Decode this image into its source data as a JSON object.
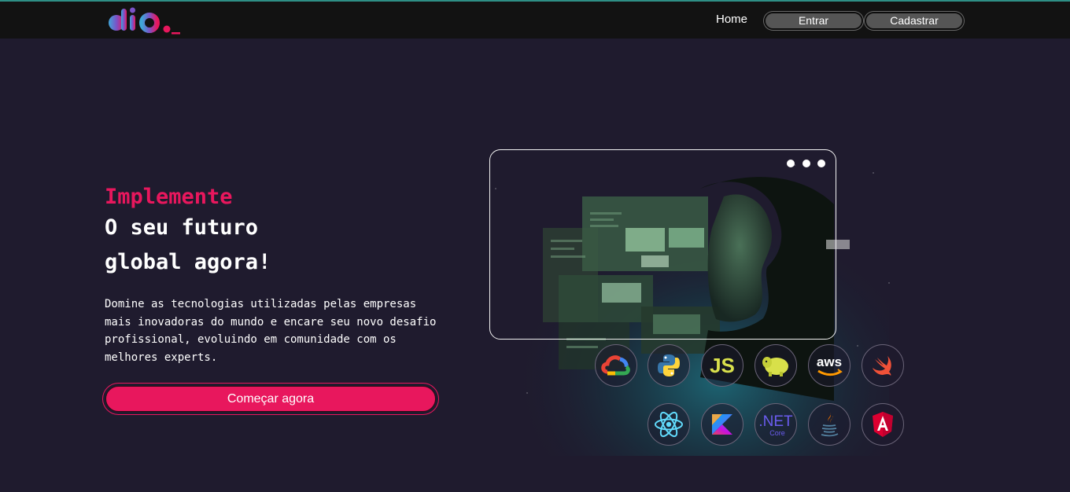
{
  "nav": {
    "home_label": "Home",
    "enter_label": "Entrar",
    "signup_label": "Cadastrar"
  },
  "hero": {
    "accent_line": "Implemente",
    "title_line1": "O seu futuro",
    "title_line2": "global agora!",
    "description": "Domine as tecnologias utilizadas pelas empresas mais inovadoras do mundo e encare seu novo desafio profissional, evoluindo em comunidade com os melhores experts.",
    "cta_label": "Começar agora"
  },
  "technologies": [
    {
      "icon": "google-cloud-icon"
    },
    {
      "icon": "python-icon"
    },
    {
      "icon": "javascript-icon",
      "text": "JS"
    },
    {
      "icon": "hadoop-icon"
    },
    {
      "icon": "aws-icon",
      "text": "aws"
    },
    {
      "icon": "swift-icon"
    },
    {
      "icon": "react-icon"
    },
    {
      "icon": "kotlin-icon"
    },
    {
      "icon": "dotnet-core-icon",
      "text": ".NET",
      "subtext": "Core"
    },
    {
      "icon": "java-icon"
    },
    {
      "icon": "angular-icon"
    }
  ],
  "colors": {
    "background": "#1f1b2e",
    "header": "#121212",
    "accent": "#e8175d",
    "top_line": "#2e8f86"
  }
}
